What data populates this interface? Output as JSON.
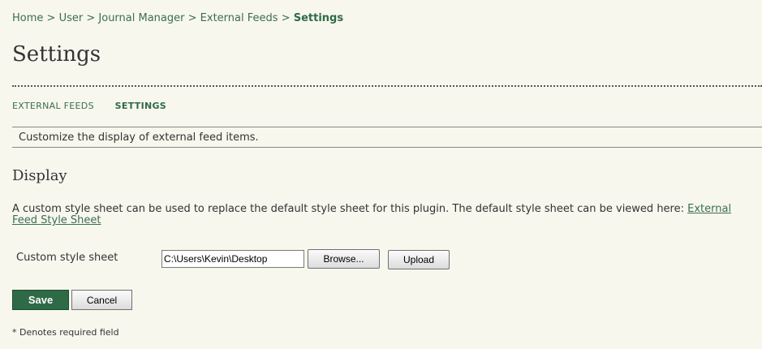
{
  "breadcrumb": {
    "items": [
      "Home",
      "User",
      "Journal Manager",
      "External Feeds"
    ],
    "current": "Settings",
    "separator": ">"
  },
  "page": {
    "title": "Settings"
  },
  "tabs": [
    {
      "label": "EXTERNAL FEEDS",
      "active": false
    },
    {
      "label": "SETTINGS",
      "active": true
    }
  ],
  "description": "Customize the display of external feed items.",
  "display": {
    "heading": "Display",
    "intro_text": "A custom style sheet can be used to replace the default style sheet for this plugin. The default style sheet can be viewed here: ",
    "link_label": "External Feed Style Sheet",
    "field_label": "Custom style sheet",
    "file_value": "C:\\Users\\Kevin\\Desktop",
    "browse_label": "Browse...",
    "upload_label": "Upload"
  },
  "form": {
    "save_label": "Save",
    "cancel_label": "Cancel",
    "required_note": "* Denotes required field"
  },
  "colors": {
    "accent": "#2f6a47",
    "link": "#3b6e51",
    "background": "#f7f7ee"
  }
}
